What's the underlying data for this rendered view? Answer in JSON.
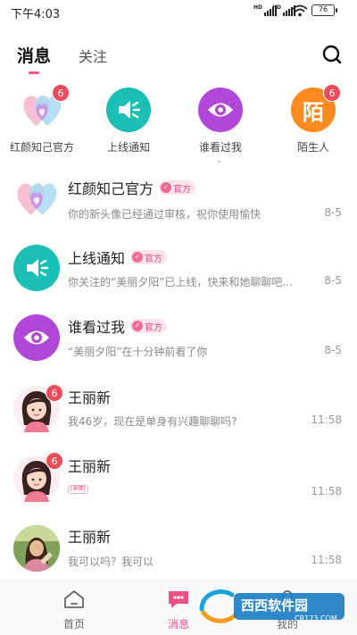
{
  "status_bar": {
    "time": "下午4:03",
    "signal1_label": "HD",
    "signal2_label": "HD",
    "battery": "76"
  },
  "tabs": [
    {
      "label": "消息"
    },
    {
      "label": "关注"
    }
  ],
  "quick_entries": [
    {
      "label": "红颜知己官方",
      "badge": "6",
      "icon": "heart-icon"
    },
    {
      "label": "上线通知",
      "badge": "",
      "icon": "speaker-icon"
    },
    {
      "label": "谁看过我",
      "badge": "",
      "icon": "eye-icon"
    },
    {
      "label": "陌生人",
      "badge": "6",
      "icon_text": "陌"
    }
  ],
  "messages": [
    {
      "name": "红颜知己官方",
      "official": "官方",
      "preview": "你的新头像已经通过审核，祝你使用愉快",
      "time": "8-5"
    },
    {
      "name": "上线通知",
      "official": "官方",
      "preview": "你关注的“美丽夕阳”已上线，快来和她聊聊吧...",
      "time": "8-5"
    },
    {
      "name": "谁看过我",
      "official": "官方",
      "preview": "“美丽夕阳”在十分钟前看了你",
      "time": "8-5"
    },
    {
      "name": "王丽新",
      "badge": "6",
      "preview": "我46岁，现在是单身有兴趣聊聊吗?",
      "time": "11:58"
    },
    {
      "name": "王丽新",
      "badge": "6",
      "preview": "",
      "preview_tag": "[表情]",
      "time": "11:58"
    },
    {
      "name": "王丽新",
      "preview": "我可以吗？我可以",
      "time": "11:58"
    }
  ],
  "bottom_nav": [
    {
      "label": "首页"
    },
    {
      "label": "消息"
    },
    {
      "label": "我的"
    }
  ],
  "watermark": {
    "brand": "西西软件园",
    "url": "CR173.COM"
  },
  "colors": {
    "accent": "#ee4f86",
    "badge": "#ec4c5a",
    "teal": "#1bbfb6",
    "purple": "#b047d8",
    "orange": "#ff8a1f"
  }
}
